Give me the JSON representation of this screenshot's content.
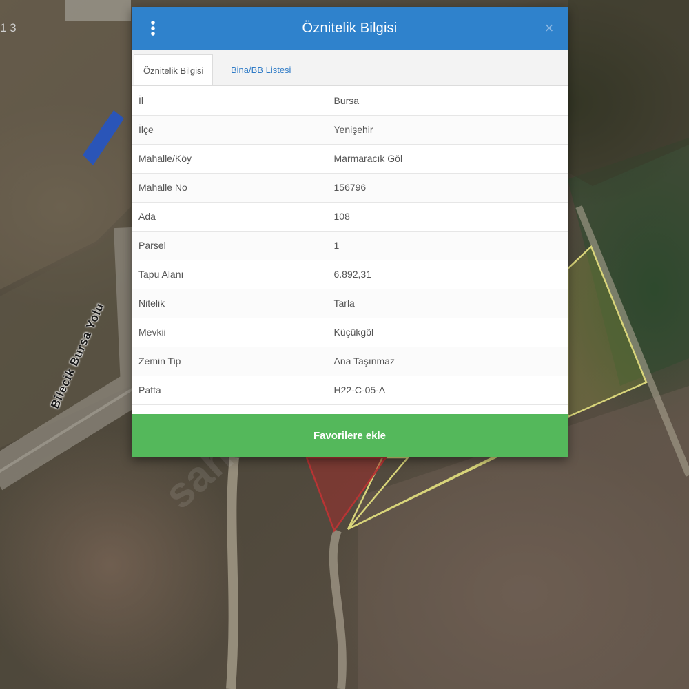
{
  "dialog": {
    "title": "Öznitelik Bilgisi",
    "close_symbol": "×",
    "menu_icon": "vertical-dots-icon",
    "tabs": [
      {
        "label": "Öznitelik Bilgisi",
        "active": true
      },
      {
        "label": "Bina/BB Listesi",
        "active": false
      }
    ],
    "rows": [
      {
        "key": "İl",
        "value": "Bursa"
      },
      {
        "key": "İlçe",
        "value": "Yenişehir"
      },
      {
        "key": "Mahalle/Köy",
        "value": "Marmaracık Göl"
      },
      {
        "key": "Mahalle No",
        "value": "156796"
      },
      {
        "key": "Ada",
        "value": "108"
      },
      {
        "key": "Parsel",
        "value": "1"
      },
      {
        "key": "Tapu Alanı",
        "value": "6.892,31"
      },
      {
        "key": "Nitelik",
        "value": "Tarla"
      },
      {
        "key": "Mevkii",
        "value": "Küçükgöl"
      },
      {
        "key": "Zemin Tip",
        "value": "Ana Taşınmaz"
      },
      {
        "key": "Pafta",
        "value": "H22-C-05-A"
      }
    ],
    "favorite_label": "Favorilere ekle"
  },
  "map": {
    "road_label": "Bilecik Bursa Yolu",
    "zoom_readout": "1 3",
    "watermark": "sahibinden",
    "colors": {
      "header": "#2f82cc",
      "favorite": "#54b85b",
      "parcel_outline": "#d8d47a",
      "selected_parcel": "#b83434"
    }
  }
}
